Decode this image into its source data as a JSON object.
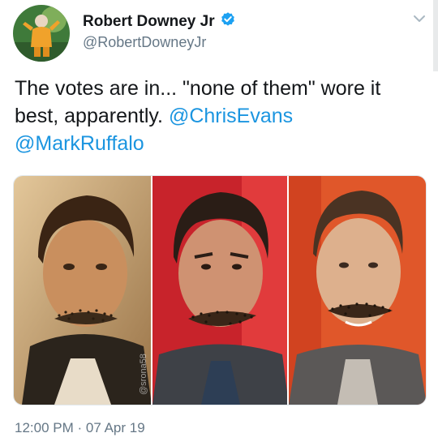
{
  "author": {
    "name": "Robert Downey Jr",
    "handle": "@RobertDowneyJr",
    "verified": true
  },
  "tweet": {
    "text_parts": [
      {
        "text": "The votes are in... \"none of them\" wore it best, apparently. ",
        "type": "plain"
      },
      {
        "text": "@ChrisEvans",
        "type": "mention"
      },
      {
        "text": " ",
        "type": "plain"
      },
      {
        "text": "@MarkRuffalo",
        "type": "mention"
      }
    ],
    "media": {
      "photo_count": 3,
      "watermark": "@srona58"
    },
    "timestamp": "12:00 PM · 07 Apr 19"
  },
  "colors": {
    "link": "#1b95e0",
    "verified_badge": "#1da1f2",
    "secondary_text": "#657786"
  },
  "icons": {
    "verified": "verified-badge-icon",
    "menu": "chevron-down-icon"
  }
}
